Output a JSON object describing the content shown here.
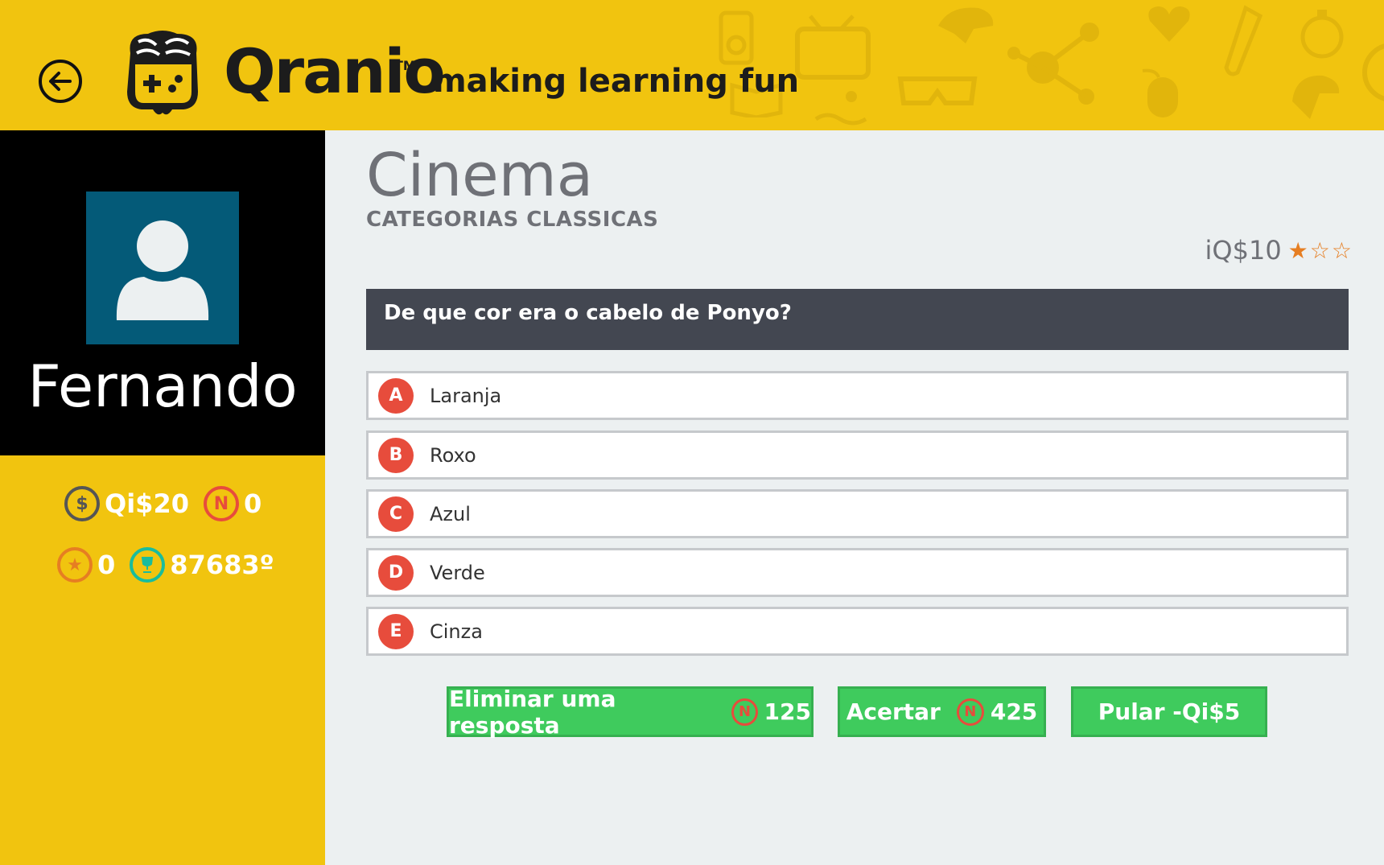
{
  "header": {
    "brand": "Qranio",
    "trademark": "TM",
    "tagline": "making learning fun"
  },
  "profile": {
    "name": "Fernando",
    "stats": {
      "coins": "Qi$20",
      "n_points": "0",
      "stars": "0",
      "trophy": "87683º"
    }
  },
  "quiz": {
    "category": "Cinema",
    "subcategory": "CATEGORIAS CLASSICAS",
    "reward": "iQ$10",
    "difficulty_stars": 1,
    "difficulty_max": 3,
    "question": "De que cor era o cabelo de Ponyo?",
    "options": [
      {
        "letter": "A",
        "text": "Laranja"
      },
      {
        "letter": "B",
        "text": "Roxo"
      },
      {
        "letter": "C",
        "text": "Azul"
      },
      {
        "letter": "D",
        "text": "Verde"
      },
      {
        "letter": "E",
        "text": "Cinza"
      }
    ]
  },
  "actions": {
    "eliminate_label": "Eliminar uma resposta",
    "eliminate_cost": "125",
    "hit_label": "Acertar",
    "hit_cost": "425",
    "skip_label": "Pular -Qi$5"
  },
  "colors": {
    "header_bg": "#f1c40f",
    "question_bg": "#434751",
    "option_letter": "#e74c3c",
    "action_green": "#3fcb5d",
    "avatar_bg": "#045a78"
  }
}
